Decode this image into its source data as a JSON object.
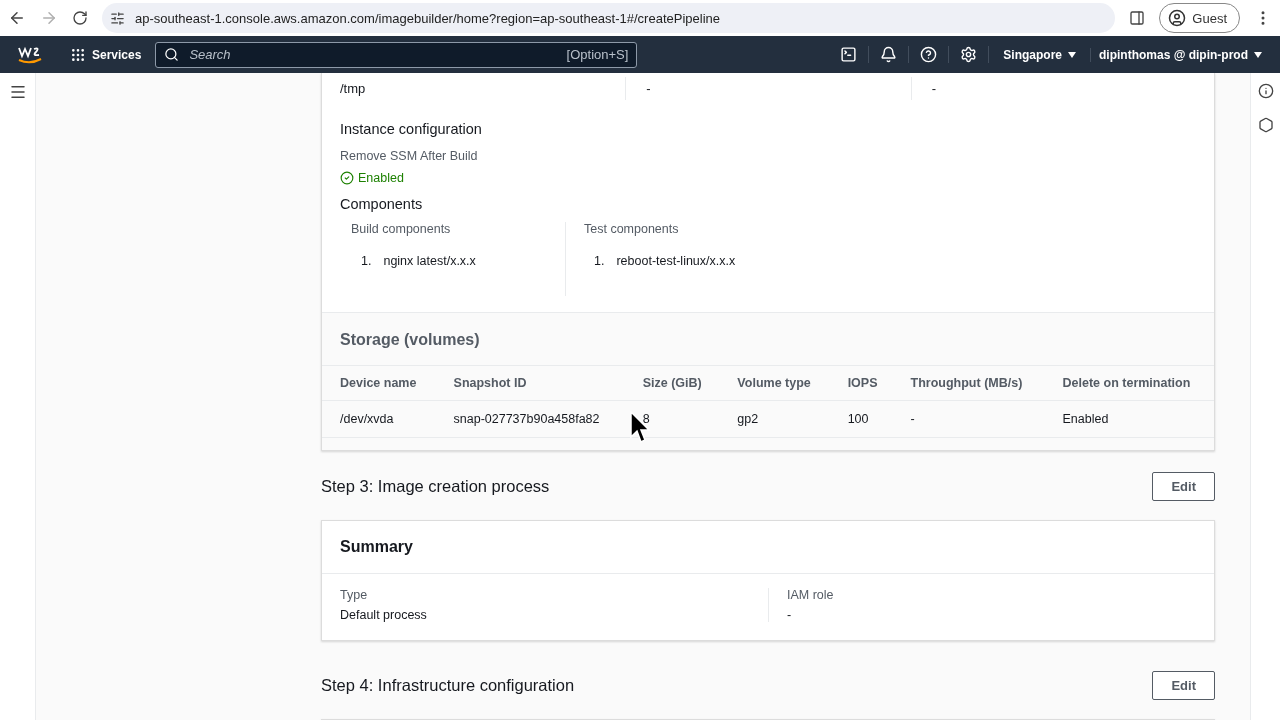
{
  "browser": {
    "url": "ap-southeast-1.console.aws.amazon.com/imagebuilder/home?region=ap-southeast-1#/createPipeline",
    "profile": "Guest",
    "forward_disabled": true
  },
  "nav": {
    "services": "Services",
    "search_placeholder": "Search",
    "shortcut": "[Option+S]",
    "region": "Singapore",
    "account": "dipinthomas @ dipin-prod"
  },
  "top_card": {
    "row": [
      "/tmp",
      "-",
      "-"
    ],
    "instance_title": "Instance configuration",
    "instance_label": "Remove SSM After Build",
    "instance_value": "Enabled",
    "components_title": "Components",
    "build": {
      "label": "Build components",
      "items": [
        {
          "num": "1.",
          "name": "nginx latest/x.x.x"
        }
      ]
    },
    "test": {
      "label": "Test components",
      "items": [
        {
          "num": "1.",
          "name": "reboot-test-linux/x.x.x"
        }
      ]
    },
    "storage": {
      "title": "Storage (volumes)",
      "columns": [
        "Device name",
        "Snapshot ID",
        "Size (GiB)",
        "Volume type",
        "IOPS",
        "Throughput (MB/s)",
        "Delete on termination"
      ],
      "rows": [
        [
          "/dev/xvda",
          "snap-027737b90a458fa82",
          "8",
          "gp2",
          "100",
          "-",
          "Enabled"
        ]
      ]
    }
  },
  "step3": {
    "title": "Step 3: Image creation process",
    "edit": "Edit",
    "card_title": "Summary",
    "fields": [
      {
        "label": "Type",
        "value": "Default process"
      },
      {
        "label": "IAM role",
        "value": "-"
      }
    ]
  },
  "step4": {
    "title": "Step 4: Infrastructure configuration",
    "edit": "Edit"
  }
}
